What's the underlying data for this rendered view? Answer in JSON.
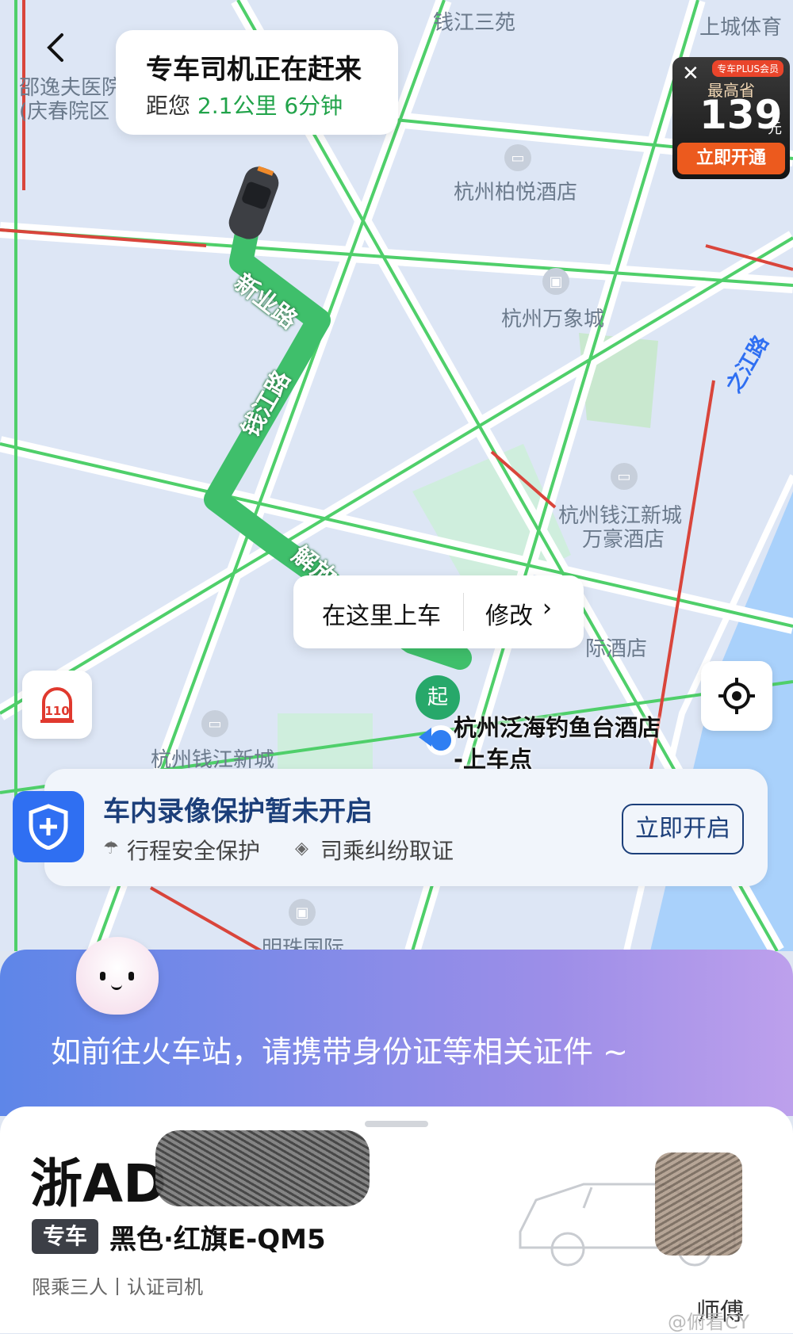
{
  "map": {
    "pois": [
      "钱江三苑",
      "上城体育",
      "邵逸夫医院",
      "(庆春院区",
      "杭州柏悦酒店",
      "杭州万象城",
      "杭州钱江新城",
      "万豪酒店",
      "际酒店",
      "杭州钱江新城",
      "明珠国际"
    ],
    "roads": [
      "新业路",
      "钱江路",
      "解放",
      "之江路"
    ]
  },
  "status": {
    "title": "专车司机正在赶来",
    "distance_prefix": "距您",
    "distance_value": "2.1公里 6分钟"
  },
  "promo": {
    "badge": "专车PLUS会员",
    "label": "最高省",
    "amount": "139",
    "unit": "元",
    "button": "立即开通"
  },
  "pickup": {
    "here": "在这里上车",
    "modify": "修改",
    "start_marker": "起",
    "name_line1": "杭州泛海钓鱼台酒店",
    "name_line2": "-上车点"
  },
  "sos_label": "110",
  "safety": {
    "title": "车内录像保护暂未开启",
    "feature1": "行程安全保护",
    "feature2": "司乘纠纷取证",
    "button": "立即开启"
  },
  "hint": "如前往火车站，请携带身份证等相关证件 ~",
  "vehicle": {
    "plate": "浙AD",
    "tag": "专车",
    "description": "黑色·红旗E-QM5",
    "meta": "限乘三人丨认证司机",
    "driver": "师傅"
  },
  "watermark": "@俯看CY",
  "colors": {
    "route": "#3fbf6b",
    "accent": "#2f6ff2",
    "promo_button": "#ec5a1e"
  }
}
